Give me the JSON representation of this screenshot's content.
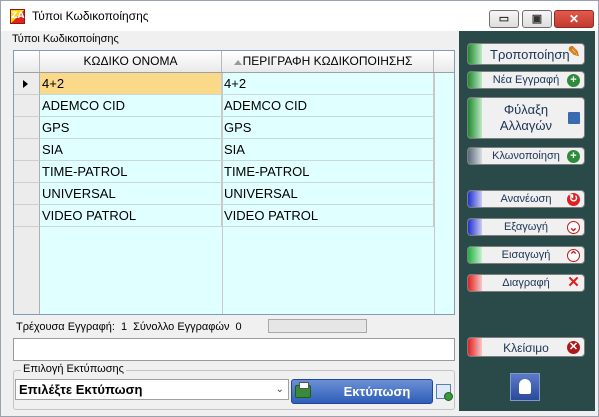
{
  "window": {
    "title": "Τύποι Κωδικοποίησης",
    "minimize_glyph": "▭",
    "maximize_glyph": "▣",
    "close_glyph": "✕"
  },
  "group": {
    "label": "Τύποι Κωδικοποίησης"
  },
  "grid": {
    "columns": [
      "ΚΩΔΙΚΟ ΟΝΟΜΑ",
      "ΠΕΡΙΓΡΑΦΗ ΚΩΔΙΚΟΠΟΙΗΣΗΣ"
    ],
    "rows": [
      [
        "4+2",
        "4+2"
      ],
      [
        "ADEMCO CID",
        "ADEMCO CID"
      ],
      [
        "GPS",
        "GPS"
      ],
      [
        "SIA",
        "SIA"
      ],
      [
        "TIME-PATROL",
        "TIME-PATROL"
      ],
      [
        "UNIVERSAL",
        "UNIVERSAL"
      ],
      [
        "VIDEO PATROL",
        "VIDEO PATROL"
      ]
    ]
  },
  "status": {
    "current_label": "Τρέχουσα Εγγραφή:",
    "current_value": "1",
    "total_label": "Σύνολλο Εγγραφών",
    "total_value": "0"
  },
  "print": {
    "label": "Επιλογή Εκτύπωσης",
    "combo_value": "Επιλέξτε Εκτύπωση",
    "button_label": "Εκτύπωση"
  },
  "actions": {
    "modify": "Τροποποίηση",
    "new_record": "Νέα Εγγραφή",
    "save_line1": "Φύλαξη",
    "save_line2": "Αλλαγών",
    "clone": "Κλωνοποίηση",
    "refresh": "Ανανέωση",
    "export": "Εξαγωγή",
    "import": "Εισαγωγή",
    "delete": "Διαγραφή",
    "close": "Κλείσιμο"
  },
  "colors": {
    "panel": "#2a4a4a",
    "grid_bg": "#e0ffff",
    "selected_cell": "#fbd98a",
    "green": "#2e8b3a",
    "blue": "#2030d0",
    "red": "#e02020"
  }
}
